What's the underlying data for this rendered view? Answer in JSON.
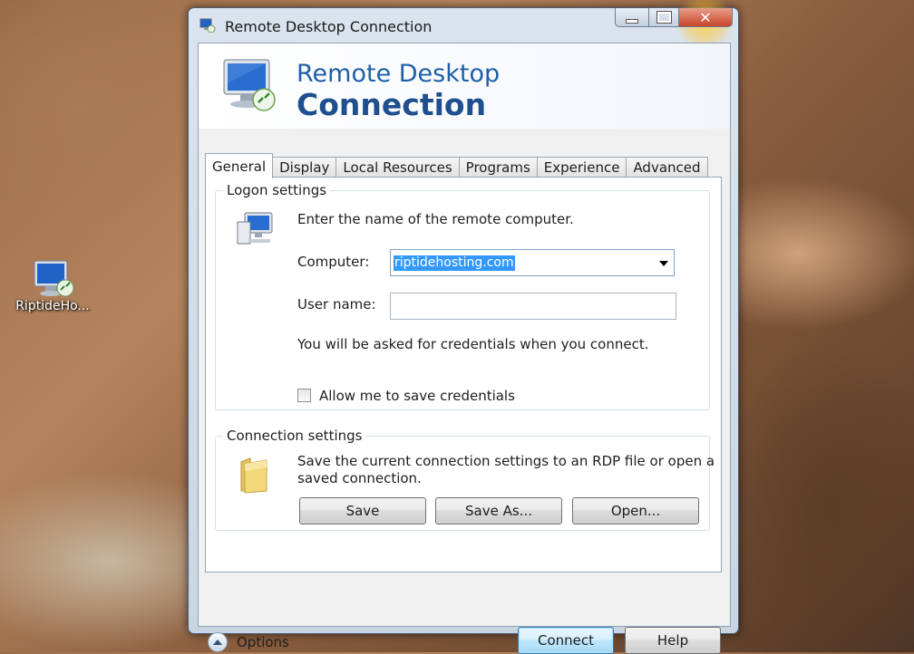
{
  "desktop": {
    "icon_label": "RiptideHo..."
  },
  "window": {
    "title": "Remote Desktop Connection",
    "close_glyph": "✕"
  },
  "banner": {
    "line1": "Remote Desktop",
    "line2": "Connection"
  },
  "tabs": [
    {
      "label": "General",
      "active": true
    },
    {
      "label": "Display"
    },
    {
      "label": "Local Resources"
    },
    {
      "label": "Programs"
    },
    {
      "label": "Experience"
    },
    {
      "label": "Advanced"
    }
  ],
  "logon": {
    "legend": "Logon settings",
    "instruction": "Enter the name of the remote computer.",
    "computer_label": "Computer:",
    "computer_value": "riptidehosting.com",
    "username_label": "User name:",
    "username_value": "",
    "credentials_note": "You will be asked for credentials when you connect.",
    "save_credentials_label": "Allow me to save credentials",
    "save_credentials_checked": false
  },
  "connection": {
    "legend": "Connection settings",
    "description_line1": "Save the current connection settings to an RDP file or open a",
    "description_line2": "saved connection.",
    "save_label": "Save",
    "save_as_label": "Save As...",
    "open_label": "Open..."
  },
  "footer": {
    "options_label": "Options",
    "connect_label": "Connect",
    "help_label": "Help"
  },
  "colors": {
    "banner_title": "#1f5fa8",
    "selection": "#3399ff",
    "close_button": "#c7452a"
  },
  "icons": [
    "rdp-monitor-icon",
    "folder-icon",
    "minimize-icon",
    "maximize-icon",
    "close-icon",
    "options-chevron-up-icon"
  ]
}
